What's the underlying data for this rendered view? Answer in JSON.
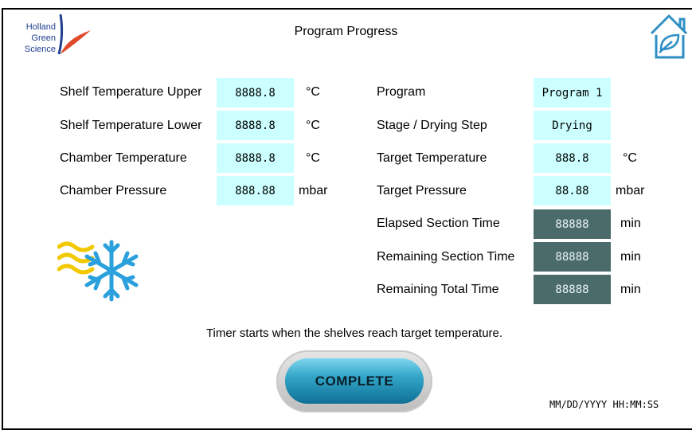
{
  "header": {
    "logo_lines": [
      "Holland",
      "Green",
      "Science"
    ],
    "title": "Program Progress"
  },
  "left_panel": [
    {
      "label": "Shelf Temperature Upper",
      "value": "8888.8",
      "unit": "°C"
    },
    {
      "label": "Shelf Temperature Lower",
      "value": "8888.8",
      "unit": "°C"
    },
    {
      "label": "Chamber Temperature",
      "value": "8888.8",
      "unit": "°C"
    },
    {
      "label": "Chamber Pressure",
      "value": "888.88",
      "unit": "mbar"
    }
  ],
  "right_panel": [
    {
      "label": "Program",
      "value": "Program 1",
      "unit": ""
    },
    {
      "label": "Stage / Drying Step",
      "value": "Drying",
      "unit": ""
    },
    {
      "label": "Target Temperature",
      "value": "888.8",
      "unit": "°C"
    },
    {
      "label": "Target Pressure",
      "value": "88.88",
      "unit": "mbar"
    },
    {
      "label": "Elapsed Section Time",
      "value": "88888",
      "unit": "min"
    },
    {
      "label": "Remaining Section Time",
      "value": "88888",
      "unit": "min"
    },
    {
      "label": "Remaining Total Time",
      "value": "88888",
      "unit": "min"
    }
  ],
  "note": "Timer starts when the shelves reach target temperature.",
  "complete_button": "COMPLETE",
  "datetime": "MM/DD/YYYY HH:MM:SS",
  "icons": {
    "home": "home-leaf-icon",
    "process": "heat-snowflake-icon"
  },
  "colors": {
    "value_box": "#ccffff",
    "time_box": "#4b6b6b",
    "button": "#2a9dc2",
    "logo_blue": "#1f3f8f",
    "logo_red": "#e04a2a"
  }
}
